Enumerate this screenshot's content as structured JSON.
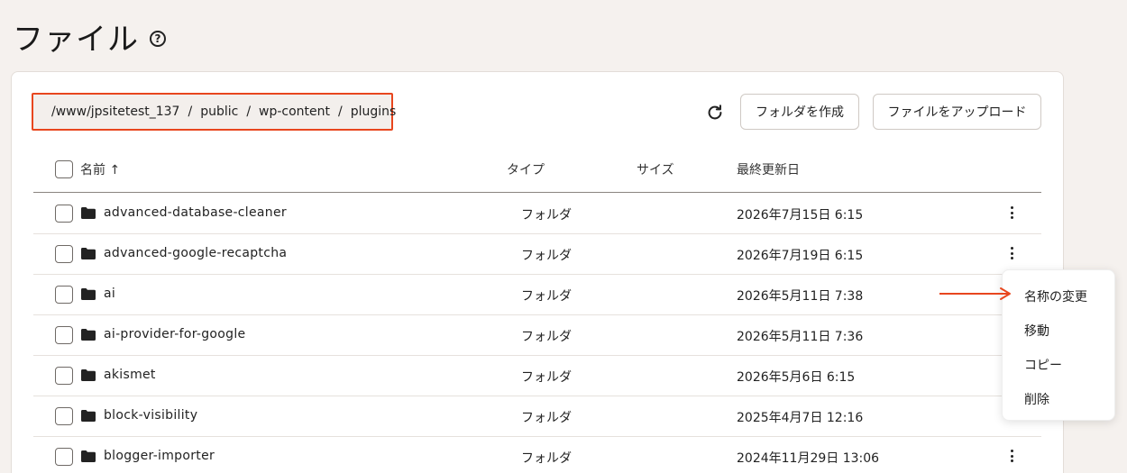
{
  "page": {
    "title": "ファイル"
  },
  "breadcrumb": {
    "segments": [
      "/www/jpsitetest_137",
      "public",
      "wp-content",
      "plugins"
    ],
    "separator": "/"
  },
  "toolbar": {
    "create_folder_label": "フォルダを作成",
    "upload_file_label": "ファイルをアップロード"
  },
  "table": {
    "columns": {
      "name": "名前 ↑",
      "type": "タイプ",
      "size": "サイズ",
      "modified": "最終更新日"
    },
    "rows": [
      {
        "name": "advanced-database-cleaner",
        "type": "フォルダ",
        "size": "",
        "modified": "2026年7月15日 6:15"
      },
      {
        "name": "advanced-google-recaptcha",
        "type": "フォルダ",
        "size": "",
        "modified": "2026年7月19日 6:15"
      },
      {
        "name": "ai",
        "type": "フォルダ",
        "size": "",
        "modified": "2026年5月11日 7:38"
      },
      {
        "name": "ai-provider-for-google",
        "type": "フォルダ",
        "size": "",
        "modified": "2026年5月11日 7:36"
      },
      {
        "name": "akismet",
        "type": "フォルダ",
        "size": "",
        "modified": "2026年5月6日 6:15"
      },
      {
        "name": "block-visibility",
        "type": "フォルダ",
        "size": "",
        "modified": "2025年4月7日 12:16"
      },
      {
        "name": "blogger-importer",
        "type": "フォルダ",
        "size": "",
        "modified": "2024年11月29日 13:06"
      }
    ]
  },
  "context_menu": {
    "items": [
      "名称の変更",
      "移動",
      "コピー",
      "削除"
    ]
  },
  "colors": {
    "accent": "#e8461e",
    "background": "#f5f1ee",
    "panel": "#ffffff"
  },
  "icons": {
    "help": "help-circle-icon",
    "refresh": "refresh-icon",
    "folder": "folder-icon",
    "more": "more-vertical-icon"
  }
}
